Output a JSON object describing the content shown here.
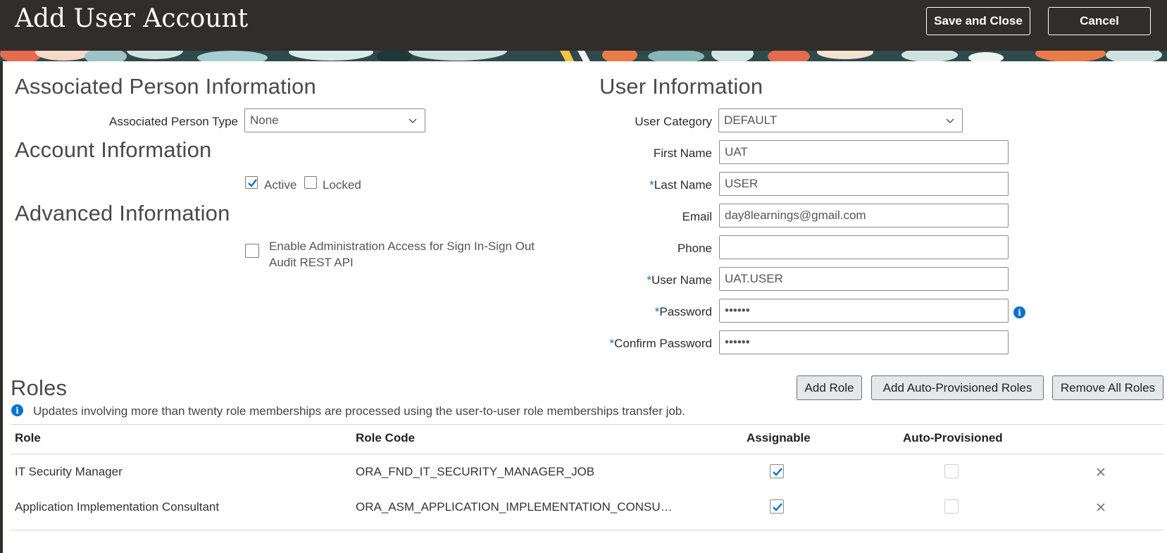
{
  "header": {
    "title": "Add User Account",
    "save_close_label": "Save and Close",
    "cancel_label": "Cancel"
  },
  "associated_person": {
    "title": "Associated Person Information",
    "type_label": "Associated Person Type",
    "type_value": "None"
  },
  "account": {
    "title": "Account Information",
    "active_label": "Active",
    "active_checked": true,
    "locked_label": "Locked",
    "locked_checked": false
  },
  "advanced": {
    "title": "Advanced Information",
    "admin_access_label_line1": "Enable Administration Access for Sign In-Sign Out",
    "admin_access_label_line2": "Audit REST API",
    "admin_access_checked": false
  },
  "user_info": {
    "title": "User Information",
    "category_label": "User Category",
    "category_value": "DEFAULT",
    "first_name_label": "First Name",
    "first_name_value": "UAT",
    "last_name_label": "Last Name",
    "last_name_value": "USER",
    "email_label": "Email",
    "email_value": "day8learnings@gmail.com",
    "phone_label": "Phone",
    "phone_value": "",
    "user_name_label": "User Name",
    "user_name_value": "UAT.USER",
    "password_label": "Password",
    "password_value": "••••••",
    "confirm_password_label": "Confirm Password",
    "confirm_password_value": "••••••",
    "required_marker": "*"
  },
  "roles": {
    "title": "Roles",
    "add_role_label": "Add Role",
    "add_auto_label": "Add Auto-Provisioned Roles",
    "remove_all_label": "Remove All Roles",
    "note": "Updates involving more than twenty role memberships are processed using the user-to-user role memberships transfer job.",
    "columns": [
      "Role",
      "Role Code",
      "Assignable",
      "Auto-Provisioned"
    ],
    "rows": [
      {
        "role": "IT Security Manager",
        "code": "ORA_FND_IT_SECURITY_MANAGER_JOB",
        "assignable": true,
        "auto_provisioned": false
      },
      {
        "role": "Application Implementation Consultant",
        "code": "ORA_ASM_APPLICATION_IMPLEMENTATION_CONSU…",
        "assignable": true,
        "auto_provisioned": false
      }
    ]
  },
  "colors": {
    "header_bg": "#312d2a",
    "accent": "#0572ce",
    "button_bg": "#e4e8ea"
  }
}
